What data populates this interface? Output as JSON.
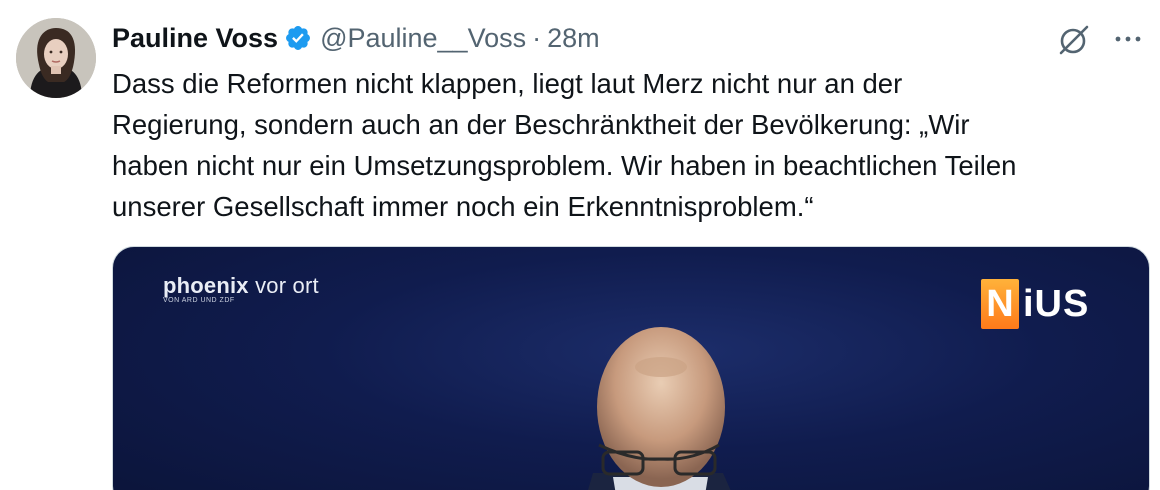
{
  "tweet": {
    "author_name": "Pauline Voss",
    "handle": "@Pauline__Voss",
    "separator": "·",
    "time": "28m",
    "text_lines": [
      "Dass die Reformen nicht klappen, liegt laut Merz nicht nur an der",
      "Regierung, sondern auch an der Beschränktheit der Bevölkerung: „Wir",
      "haben nicht nur ein Umsetzungsproblem. Wir haben in beachtlichen Teilen",
      "unserer Gesellschaft immer noch ein Erkenntnisproblem.“"
    ]
  },
  "icons": {
    "verified": "verified-badge-icon",
    "grok": "grok-icon",
    "more": "more-options-icon"
  },
  "media": {
    "broadcaster_logo_bold": "phoenix",
    "broadcaster_logo_rest": "vor ort",
    "broadcaster_logo_sub": "VON ARD UND ZDF",
    "watermark_first": "N",
    "watermark_rest": "iUS"
  },
  "colors": {
    "verified_blue": "#1d9bf0",
    "secondary_text": "#536471",
    "nius_orange": "#ff8a1f",
    "stage_blue": "#101c4e"
  }
}
